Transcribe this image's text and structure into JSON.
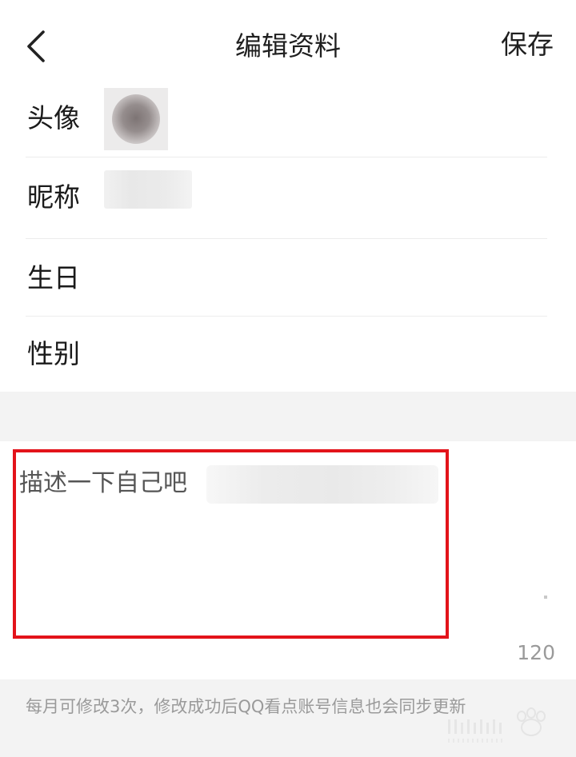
{
  "header": {
    "title": "编辑资料",
    "save_label": "保存",
    "back_icon": "chevron-left-icon"
  },
  "fields": {
    "avatar_label": "头像",
    "nickname_label": "昵称",
    "birthday_label": "生日",
    "gender_label": "性别"
  },
  "bio": {
    "placeholder": "描述一下自己吧",
    "char_limit": "120",
    "highlight_color": "#e3131a"
  },
  "footer": {
    "note": "每月可修改3次，修改成功后QQ看点账号信息也会同步更新"
  },
  "colors": {
    "background": "#ffffff",
    "section_gap": "#f3f3f3",
    "divider": "#ececec"
  }
}
